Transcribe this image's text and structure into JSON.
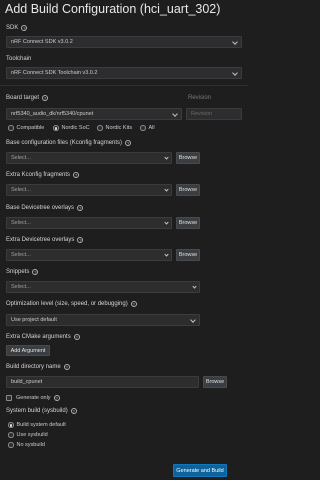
{
  "page": {
    "title": "Add Build Configuration (hci_uart_302)"
  },
  "sdk": {
    "label": "SDK",
    "value": "nRF Connect SDK v3.0.2"
  },
  "toolchain": {
    "label": "Toolchain",
    "value": "nRF Connect SDK Toolchain v3.0.2"
  },
  "board_target": {
    "label": "Board target",
    "value": "nrf5340_audio_dk/nrf5340/cpunet",
    "revision_label": "Revision",
    "revision_placeholder": "Revision",
    "filters": [
      {
        "label": "Compatible",
        "selected": false
      },
      {
        "label": "Nordic SoC",
        "selected": true
      },
      {
        "label": "Nordic Kits",
        "selected": false
      },
      {
        "label": "All",
        "selected": false
      }
    ]
  },
  "base_kconfig": {
    "label": "Base configuration files (Kconfig fragments)",
    "placeholder": "Select...",
    "browse": "Browse"
  },
  "extra_kconfig": {
    "label": "Extra Kconfig fragments",
    "placeholder": "Select...",
    "browse": "Browse"
  },
  "base_dt": {
    "label": "Base Devicetree overlays",
    "placeholder": "Select...",
    "browse": "Browse"
  },
  "extra_dt": {
    "label": "Extra Devicetree overlays",
    "placeholder": "Select...",
    "browse": "Browse"
  },
  "snippets": {
    "label": "Snippets",
    "placeholder": "Select..."
  },
  "optimization": {
    "label": "Optimization level (size, speed, or debugging)",
    "value": "Use project default"
  },
  "cmake": {
    "label": "Extra CMake arguments",
    "button": "Add Argument"
  },
  "build_dir": {
    "label": "Build directory name",
    "value": "build_cpunet",
    "browse": "Browse"
  },
  "generate_only": {
    "label": "Generate only",
    "checked": false
  },
  "sysbuild": {
    "label": "System build (sysbuild)",
    "options": [
      {
        "label": "Build system default",
        "selected": true
      },
      {
        "label": "Use sysbuild",
        "selected": false
      },
      {
        "label": "No sysbuild",
        "selected": false
      }
    ]
  },
  "footer": {
    "generate_button": "Generate and Build"
  },
  "colors": {
    "background": "#1e1e1e",
    "input": "#2d2d30",
    "primary": "#0e639c"
  }
}
